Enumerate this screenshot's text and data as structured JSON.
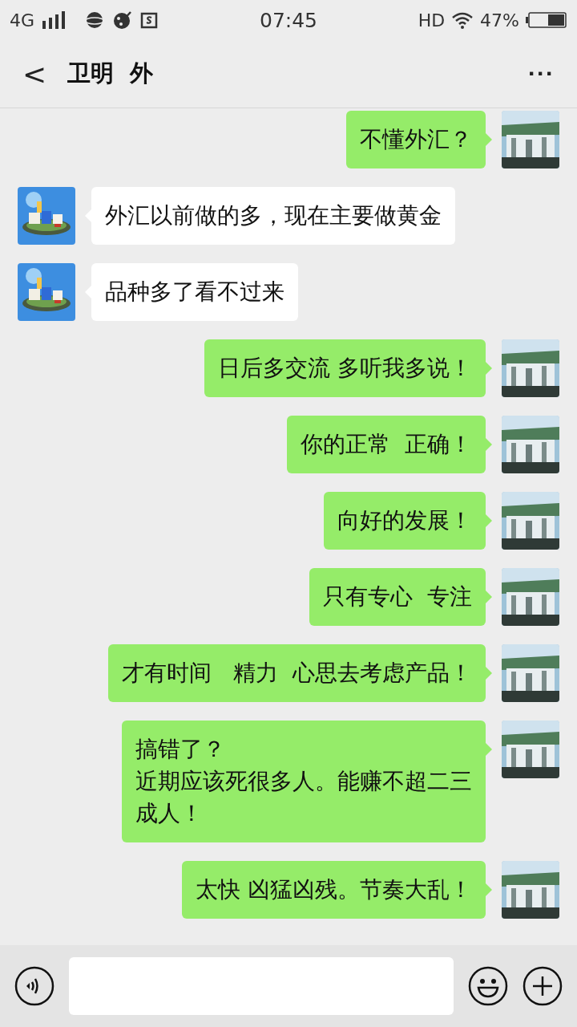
{
  "status_bar": {
    "network": "4G",
    "time": "07:45",
    "hd": "HD",
    "battery": "47%"
  },
  "header": {
    "back": "<",
    "title": "卫明  外",
    "menu": "···"
  },
  "messages": [
    {
      "kind": "sent",
      "lines": [
        "不懂外汇？"
      ]
    },
    {
      "kind": "received",
      "lines": [
        "外汇以前做的多，现在主要做黄金"
      ]
    },
    {
      "kind": "received",
      "lines": [
        "品种多了看不过来"
      ]
    },
    {
      "kind": "sent",
      "lines": [
        "日后多交流 多听我多说！"
      ]
    },
    {
      "kind": "sent",
      "lines": [
        "你的正常  正确！"
      ]
    },
    {
      "kind": "sent",
      "lines": [
        "向好的发展！"
      ]
    },
    {
      "kind": "sent",
      "lines": [
        "只有专心  专注"
      ]
    },
    {
      "kind": "sent",
      "lines": [
        "才有时间   精力  心思去考虑产品！"
      ]
    },
    {
      "kind": "sent",
      "lines": [
        "搞错了？",
        "近期应该死很多人。能赚不超二三",
        "成人！"
      ]
    },
    {
      "kind": "sent",
      "lines": [
        "太快 凶猛凶残。节奏大乱！"
      ]
    }
  ]
}
